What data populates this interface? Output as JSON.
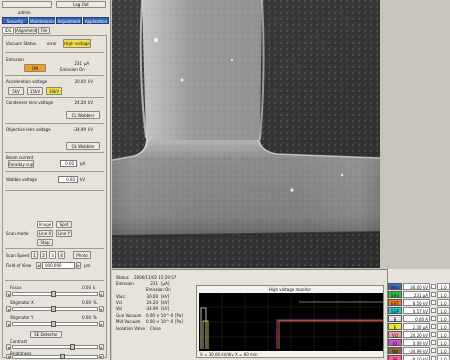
{
  "toolbar": {
    "top_left_label": "",
    "logout_label": "Log Out",
    "user_label": "admin"
  },
  "tabs": [
    {
      "label": "Security"
    },
    {
      "label": "Maintenance"
    },
    {
      "label": "Adjustment"
    },
    {
      "label": "Application"
    }
  ],
  "subtabs": {
    "ids": "IDS",
    "alignment": "Alignment",
    "file": "File"
  },
  "vacuum": {
    "label": "Vacuum Status",
    "value": "error",
    "hv_button": "High voltage"
  },
  "emission": {
    "label": "Emission",
    "on_button": "ON",
    "value": "231",
    "unit": "μA",
    "status": "Emission On"
  },
  "acceleration": {
    "label": "Acceleration voltage",
    "value": "30.00",
    "unit": "kV",
    "presets": [
      "5kV",
      "15kV",
      "30kV"
    ]
  },
  "condenser": {
    "label": "Condenser lens voltage",
    "value": "24.20",
    "unit": "kV",
    "wobbler": "CL Wobbler"
  },
  "objective": {
    "label": "Objective lens voltage",
    "value": "-34.99",
    "unit": "kV",
    "wobbler": "OL Wobbler"
  },
  "beam": {
    "label": "Beam current",
    "faraday_label": "Faraday cup",
    "value": "0.00",
    "unit": "pA"
  },
  "wobble": {
    "label": "Wobble voltage",
    "value": "0.00",
    "unit": "kV"
  },
  "scan_mode": {
    "label": "Scan mode",
    "buttons": [
      "Image",
      "Spot",
      "Line X",
      "Line Y",
      "Stop"
    ]
  },
  "scan_speed": {
    "label": "Scan Speed",
    "speeds": [
      "1",
      "2",
      "3",
      "4"
    ],
    "photo": "Photo"
  },
  "field_of_view": {
    "label": "Field of View",
    "value": "000.000",
    "unit": "μm"
  },
  "focus": {
    "label": "Focus",
    "value": "0.00",
    "unit": "k"
  },
  "stigmator_x": {
    "label": "Stigmator X",
    "value": "0.00",
    "unit": "%"
  },
  "stigmator_y": {
    "label": "Stigmator Y",
    "value": "0.00",
    "unit": "%"
  },
  "se_detector": "SE Detector",
  "contrast": {
    "label": "Contrast",
    "value": ""
  },
  "brightness": {
    "label": "Brightness",
    "value": ""
  },
  "status": {
    "title": "Status",
    "datetime": "2006/11/02 15:29:57",
    "emission_label": "Emission",
    "emission_value": "231",
    "emission_unit": "[μA]",
    "emission_state": "Emission On",
    "vacc_label": "Vacc",
    "vacc_value": "30.00",
    "vacc_unit": "[kV]",
    "vcl_label": "Vcl",
    "vcl_value": "24.20",
    "vcl_unit": "[kV]",
    "vol_label": "Vol",
    "vol_value": "-34.99",
    "vol_unit": "[kV]",
    "gun_vac_label": "Gun Vacuum",
    "gun_vac_value": "0.00 × 10^-0",
    "gun_vac_unit": "[Pa]",
    "mid_vac_label": "Mid Vacuum",
    "mid_vac_value": "0.00 × 10^-0",
    "mid_vac_unit": "[Pa]",
    "iso_label": "Isolation Valve",
    "iso_value": "Close"
  },
  "hv_monitor": {
    "title": "High voltage monitor",
    "footer": "X = 30.00 kV/div  X = 60 min"
  },
  "meters": [
    {
      "name": "Vacc",
      "value": "30.00",
      "unit": "kV",
      "scale": "1.0",
      "color": "#3c6fc8"
    },
    {
      "name": "Emi",
      "value": "231",
      "unit": "μA",
      "scale": "1.0",
      "color": "#2fbf4a"
    },
    {
      "name": "EXT",
      "value": "8.50",
      "unit": "kV",
      "scale": "1.0",
      "color": "#f07a1c"
    },
    {
      "name": "SUP",
      "value": "0.57",
      "unit": "kV",
      "scale": "1.0",
      "color": "#1fd0d0"
    },
    {
      "name": "B",
      "value": "0.00",
      "unit": "A",
      "scale": "1.0",
      "color": "#e6e6e6"
    },
    {
      "name": "E",
      "value": "2.30",
      "unit": "μA",
      "scale": "1.0",
      "color": "#e8e830"
    },
    {
      "name": "Vcl",
      "value": "24.20",
      "unit": "kV",
      "scale": "1.0",
      "color": "#f0a0a0"
    },
    {
      "name": "Icl",
      "value": "0.09",
      "unit": "kV",
      "scale": "1.0",
      "color": "#d050d0"
    },
    {
      "name": "Vol",
      "value": "-34.99",
      "unit": "kV",
      "scale": "1.0",
      "color": "#8a6a38"
    },
    {
      "name": "Iol",
      "value": "-0.10",
      "unit": "kV",
      "scale": "1.0",
      "color": "#ff5aa0"
    }
  ],
  "colors": {
    "accent_blue": "#3566c0",
    "on_button": "#f0a020",
    "hv_button": "#f4e04a",
    "panel_bg": "#e6e3da"
  }
}
